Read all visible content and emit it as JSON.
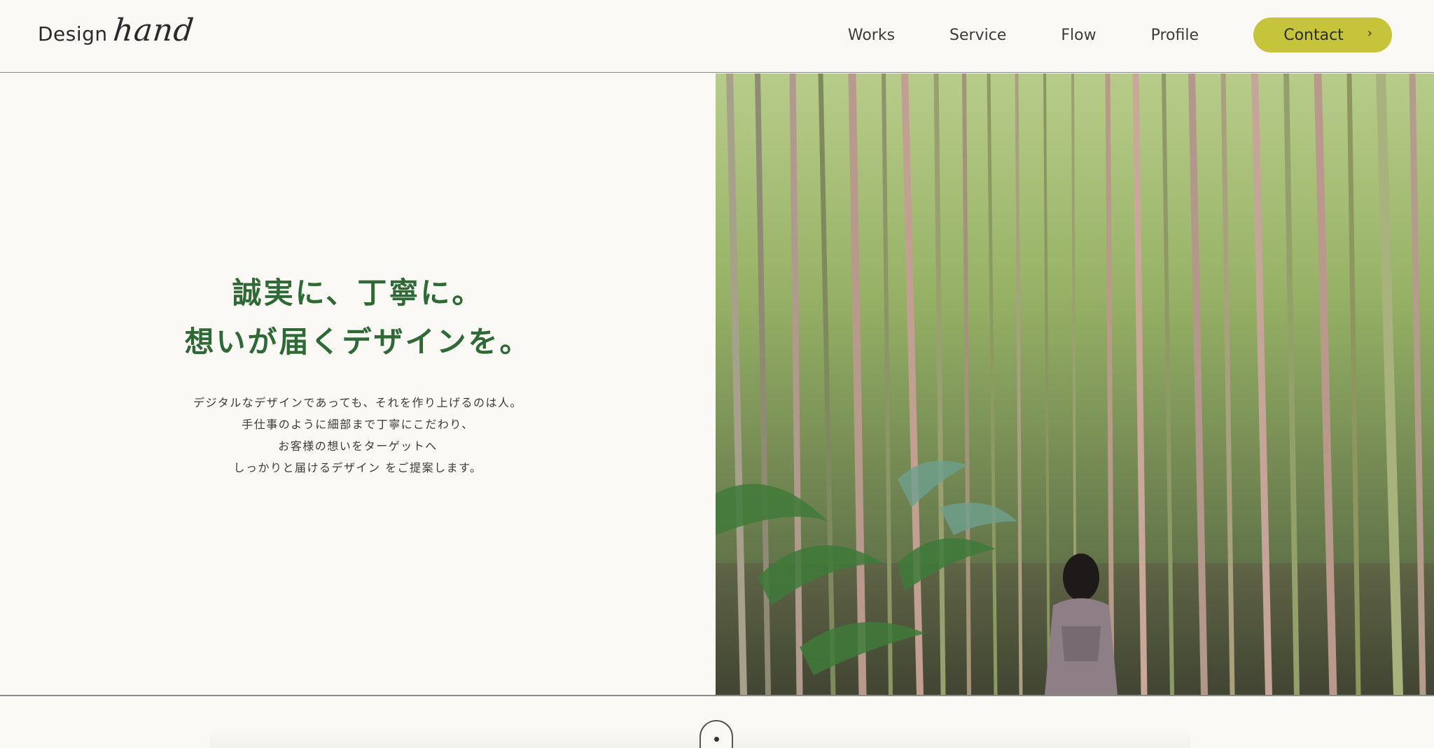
{
  "header": {
    "logo_design": "Design",
    "logo_hand": "hand",
    "nav": [
      "Works",
      "Service",
      "Flow",
      "Profile"
    ],
    "contact_label": "Contact",
    "contact_chevron": "›"
  },
  "hero": {
    "title_line1": "誠実に、丁寧に。",
    "title_line2": "想いが届くデザインを。",
    "body": [
      "デジタルなデザインであっても、それを作り上げるのは人。",
      "手仕事のように細部まで丁寧にこだわり、",
      "お客様の想いをターゲットへ",
      "しっかりと届けるデザイン をご提案します。"
    ],
    "image_alt": "Bamboo forest with a person standing"
  },
  "colors": {
    "background": "#fbf9f5",
    "heading_green": "#2f6a36",
    "contact_button": "#c6c43b",
    "divider": "#8a8a8a"
  }
}
